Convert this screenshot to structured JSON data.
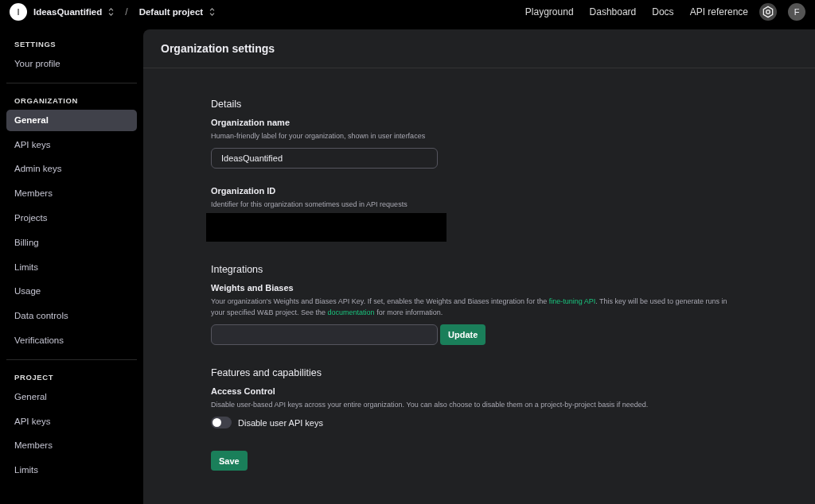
{
  "topbar": {
    "org_initial": "I",
    "org_name": "IdeasQuantified",
    "separator": "/",
    "project_name": "Default project",
    "links": [
      "Playground",
      "Dashboard",
      "Docs",
      "API reference"
    ],
    "avatar_initial": "F"
  },
  "sidebar": {
    "sections": [
      {
        "heading": "SETTINGS",
        "items": [
          {
            "label": "Your profile",
            "selected": false
          }
        ]
      },
      {
        "heading": "ORGANIZATION",
        "items": [
          {
            "label": "General",
            "selected": true
          },
          {
            "label": "API keys",
            "selected": false
          },
          {
            "label": "Admin keys",
            "selected": false
          },
          {
            "label": "Members",
            "selected": false
          },
          {
            "label": "Projects",
            "selected": false
          },
          {
            "label": "Billing",
            "selected": false
          },
          {
            "label": "Limits",
            "selected": false
          },
          {
            "label": "Usage",
            "selected": false
          },
          {
            "label": "Data controls",
            "selected": false
          },
          {
            "label": "Verifications",
            "selected": false
          }
        ]
      },
      {
        "heading": "PROJECT",
        "items": [
          {
            "label": "General",
            "selected": false
          },
          {
            "label": "API keys",
            "selected": false
          },
          {
            "label": "Members",
            "selected": false
          },
          {
            "label": "Limits",
            "selected": false
          }
        ]
      }
    ]
  },
  "page": {
    "title": "Organization settings",
    "sections": [
      {
        "heading": "Details",
        "fields": [
          {
            "kind": "text_input",
            "label": "Organization name",
            "description": [
              {
                "kind": "text",
                "text": "Human-friendly label for your organization, shown in user interfaces"
              }
            ],
            "value": "IdeasQuantified"
          },
          {
            "kind": "redacted",
            "label": "Organization ID",
            "description": [
              {
                "kind": "text",
                "text": "Identifier for this organization sometimes used in API requests"
              }
            ]
          }
        ]
      },
      {
        "heading": "Integrations",
        "fields": [
          {
            "kind": "input_button",
            "label": "Weights and Biases",
            "description": [
              {
                "kind": "text",
                "text": "Your organization's Weights and Biases API Key. If set, enables the Weights and Biases integration for the "
              },
              {
                "kind": "link",
                "text": "fine-tuning API"
              },
              {
                "kind": "text",
                "text": ". This key will be used to generate runs in your specified W&B project. See the "
              },
              {
                "kind": "link",
                "text": "documentation"
              },
              {
                "kind": "text",
                "text": " for more information."
              }
            ],
            "button": "Update"
          }
        ]
      },
      {
        "heading": "Features and capabilities",
        "fields": [
          {
            "kind": "toggle",
            "label": "Access Control",
            "description": [
              {
                "kind": "text",
                "text": "Disable user-based API keys across your entire organization. You can also choose to disable them on a project-by-project basis if needed."
              }
            ],
            "toggle_label": "Disable user API keys",
            "on": false
          }
        ]
      }
    ],
    "save_button": "Save"
  }
}
